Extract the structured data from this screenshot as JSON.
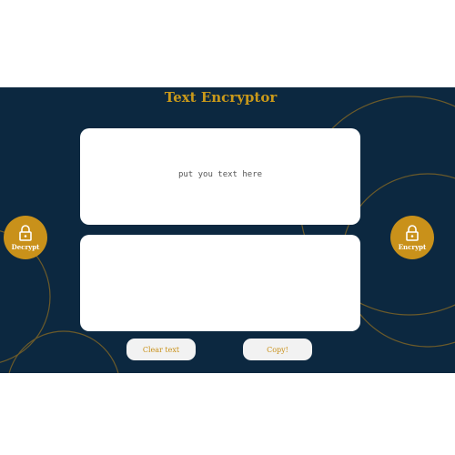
{
  "app": {
    "title": "Text Encryptor",
    "input_placeholder": "put you text here",
    "output_value": "",
    "decrypt_label": "Decrypt",
    "encrypt_label": "Encrypt",
    "clear_label": "Clear text",
    "copy_label": "Copy!",
    "decrypt_icon": "lock-icon",
    "encrypt_icon": "lock-icon"
  },
  "colors": {
    "background": "#0c2840",
    "accent": "#c9911a",
    "panel": "#ffffff",
    "button": "#f2f2f2"
  }
}
